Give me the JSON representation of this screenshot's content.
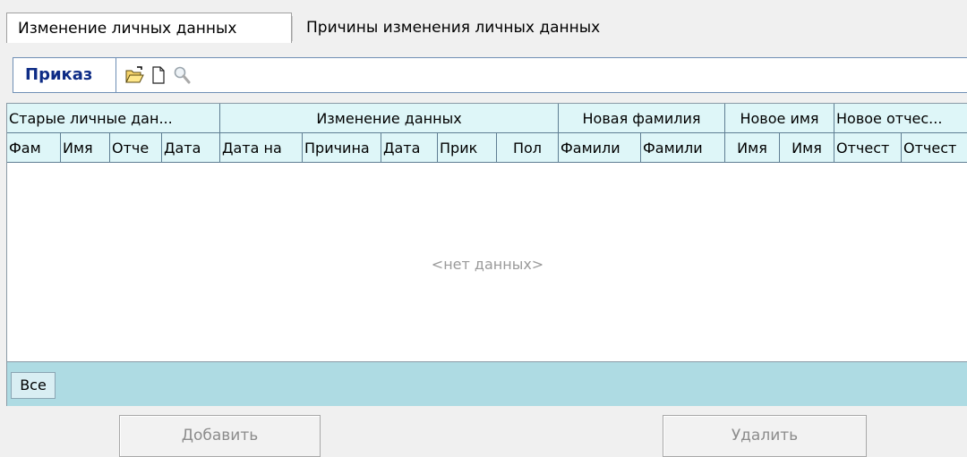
{
  "tabs": [
    {
      "label": "Изменение личных данных",
      "active": true
    },
    {
      "label": "Причины изменения личных данных",
      "active": false
    }
  ],
  "toolbar": {
    "label": "Приказ",
    "icons": [
      "open-folder-icon",
      "new-document-icon",
      "search-icon"
    ]
  },
  "grid": {
    "bands": [
      "Старые личные дан...",
      "Изменение данных",
      "Новая фамилия",
      "Новое имя",
      "Новое отчес..."
    ],
    "columns": [
      "Фам",
      "Имя",
      "Отче",
      "Дата",
      "Дата на",
      "Причина",
      "Дата",
      "Прик",
      "Пол",
      "Фамили",
      "Фамили",
      "Имя",
      "Имя",
      "Отчест",
      "Отчест"
    ],
    "empty_text": "<нет данных>",
    "filter_button": "Все"
  },
  "buttons": {
    "add": "Добавить",
    "delete": "Удалить"
  },
  "colors": {
    "header_bg": "#def6f8",
    "footer_bg": "#aedbe3",
    "label_color": "#0e2c86"
  }
}
